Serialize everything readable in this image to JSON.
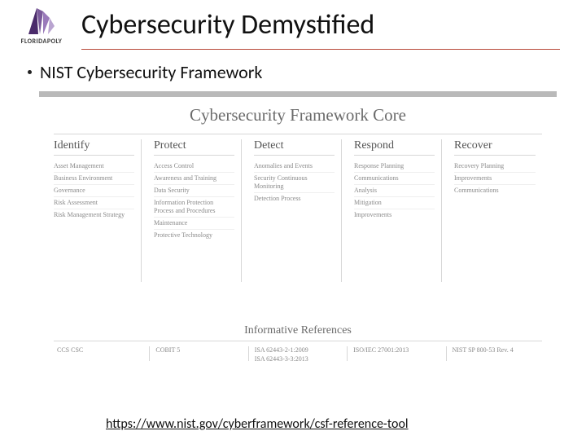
{
  "logo": {
    "brand": "FLORIDAPOLY"
  },
  "slide_title": "Cybersecurity Demystified",
  "bullet": "NIST Cybersecurity Framework",
  "panel_title": "Cybersecurity Framework Core",
  "columns": [
    {
      "head": "Identify",
      "items": [
        "Asset Management",
        "Business Environment",
        "Governance",
        "Risk Assessment",
        "Risk Management Strategy"
      ]
    },
    {
      "head": "Protect",
      "items": [
        "Access Control",
        "Awareness and Training",
        "Data Security",
        "Information Protection Process and Procedures",
        "Maintenance",
        "Protective Technology"
      ]
    },
    {
      "head": "Detect",
      "items": [
        "Anomalies and Events",
        "Security Continuous Monitoring",
        "Detection Process"
      ]
    },
    {
      "head": "Respond",
      "items": [
        "Response Planning",
        "Communications",
        "Analysis",
        "Mitigation",
        "Improvements"
      ]
    },
    {
      "head": "Recover",
      "items": [
        "Recovery Planning",
        "Improvements",
        "Communications"
      ]
    }
  ],
  "informative": {
    "title": "Informative References",
    "refs": [
      "CCS CSC",
      "COBIT 5",
      "ISA 62443-2-1:2009\nISA 62443-3-3:2013",
      "ISO/IEC 27001:2013",
      "NIST SP 800-53 Rev. 4"
    ]
  },
  "url": "https://www.nist.gov/cyberframework/csf-reference-tool"
}
